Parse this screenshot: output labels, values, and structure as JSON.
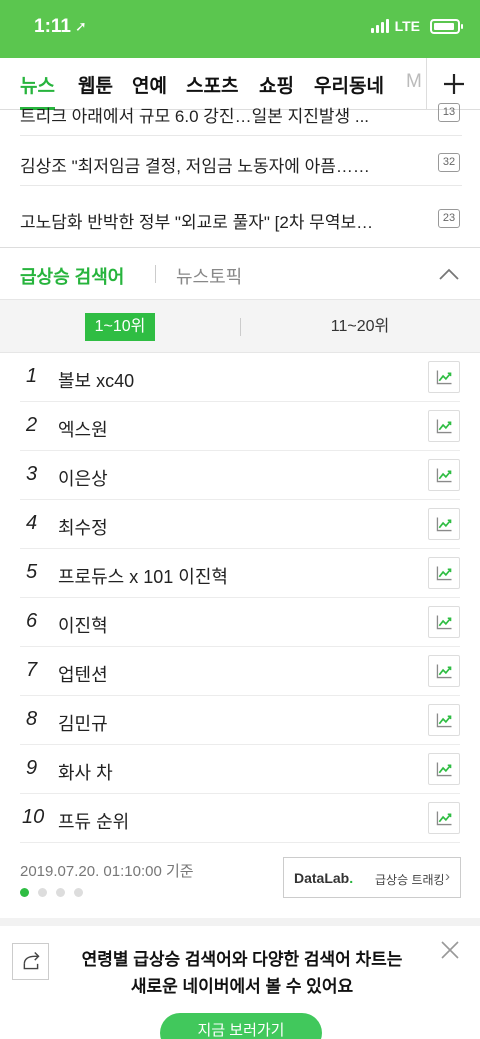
{
  "status_bar": {
    "time": "1:11",
    "network": "LTE"
  },
  "nav": {
    "tabs": [
      "뉴스",
      "웹툰",
      "연예",
      "스포츠",
      "쇼핑",
      "우리동네",
      "M"
    ],
    "active_tab": "뉴스",
    "plus_label": "+"
  },
  "news": [
    {
      "title": "트리크 아래에서 규모 6.0 강진…일본 지진발생 ...",
      "count": "13"
    },
    {
      "title": "김상조 \"최저임금 결정, 저임금 노동자에 아픔……",
      "count": "32"
    },
    {
      "title": "고노담화 반박한 정부 \"외교로 풀자\" [2차 무역보…",
      "count": "23"
    }
  ],
  "rank_header": {
    "active": "급상승 검색어",
    "inactive": "뉴스토픽"
  },
  "segments": {
    "first": "1~10위",
    "second": "11~20위"
  },
  "ranking": [
    {
      "rank": "1",
      "keyword": "볼보 xc40"
    },
    {
      "rank": "2",
      "keyword": "엑스원"
    },
    {
      "rank": "3",
      "keyword": "이은상"
    },
    {
      "rank": "4",
      "keyword": "최수정"
    },
    {
      "rank": "5",
      "keyword": "프로듀스 x 101 이진혁"
    },
    {
      "rank": "6",
      "keyword": "이진혁"
    },
    {
      "rank": "7",
      "keyword": "업텐션"
    },
    {
      "rank": "8",
      "keyword": "김민규"
    },
    {
      "rank": "9",
      "keyword": "화사 차"
    },
    {
      "rank": "10",
      "keyword": "프듀 순위"
    }
  ],
  "footer": {
    "timestamp": "2019.07.20. 01:10:00 기준",
    "datalab_brand": "DataLab",
    "datalab_dot": ".",
    "datalab_text": "급상승 트래킹",
    "pager_total": 4,
    "pager_current": 1
  },
  "banner": {
    "line1": "연령별 급상승 검색어와 다양한 검색어 차트는",
    "line2": "새로운 네이버에서 볼 수 있어요",
    "cta": "지금 보러가기"
  },
  "colors": {
    "brand_green": "#5bc64f",
    "accent_green": "#27b43d"
  },
  "icons": [
    "location-arrow-icon",
    "signal-icon",
    "battery-icon",
    "plus-icon",
    "chevron-up-icon",
    "trend-chart-icon",
    "share-icon",
    "close-icon",
    "chevron-right-icon"
  ]
}
